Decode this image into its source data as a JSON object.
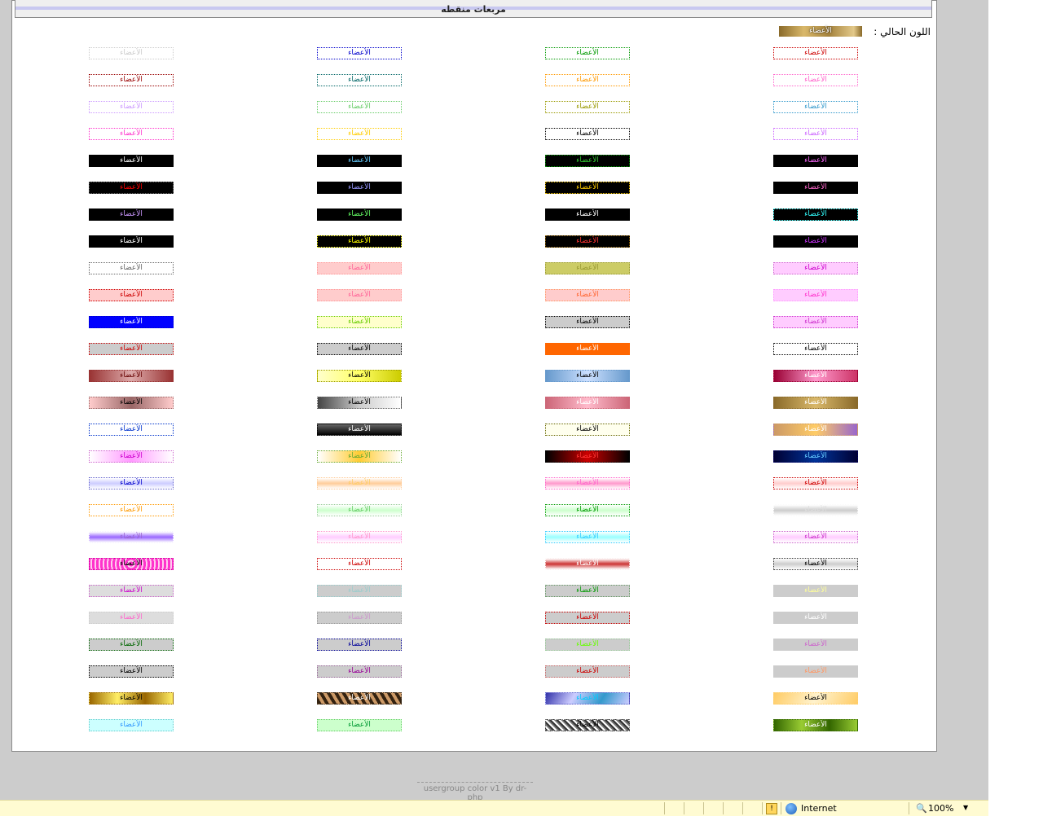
{
  "page": {
    "header_title": "مربعات منقطه",
    "current_label": "اللون الحالي :",
    "swatch_text": "الأعضاء",
    "footer": "usergroup color v1 By dr-php"
  },
  "statusbar": {
    "zone": "Internet",
    "zoom": "100%"
  },
  "colors": {
    "window_bg": "#cccccc",
    "header_bar": "#c8c8f0",
    "statusbar_bg": "#fffbd2"
  },
  "swatches": [
    {
      "bg": "#ffffff",
      "fg": "#cccccc",
      "border": "#cccccc"
    },
    {
      "bg": "#ffffff",
      "fg": "#0000cc",
      "border": "#0000cc"
    },
    {
      "bg": "#ffffff",
      "fg": "#009900",
      "border": "#009900"
    },
    {
      "bg": "#ffffff",
      "fg": "#cc0000",
      "border": "#cc0000"
    },
    {
      "bg": "#ffffff",
      "fg": "#990000",
      "border": "#990000"
    },
    {
      "bg": "#ffffff",
      "fg": "#006666",
      "border": "#006666"
    },
    {
      "bg": "#ffffff",
      "fg": "#ff9900",
      "border": "#ff9900"
    },
    {
      "bg": "#ffffff",
      "fg": "#ff66cc",
      "border": "#ff66cc"
    },
    {
      "bg": "#ffffff",
      "fg": "#cc99ff",
      "border": "#cc99ff"
    },
    {
      "bg": "#ffffff",
      "fg": "#66cc66",
      "border": "#66cc66"
    },
    {
      "bg": "#ffffff",
      "fg": "#999900",
      "border": "#999900"
    },
    {
      "bg": "#ffffff",
      "fg": "#3399cc",
      "border": "#3399cc"
    },
    {
      "bg": "#ffffff",
      "fg": "#ff33cc",
      "border": "#ff33cc"
    },
    {
      "bg": "#ffffff",
      "fg": "#ffcc00",
      "border": "#ffcc00"
    },
    {
      "bg": "#ffffff",
      "fg": "#000000",
      "border": "#000000"
    },
    {
      "bg": "#ffffff",
      "fg": "#cc66ff",
      "border": "#cc66ff"
    },
    {
      "bg": "#000000",
      "fg": "#ffffff",
      "border": "#000000"
    },
    {
      "bg": "#000000",
      "fg": "#66ccff",
      "border": "#000000"
    },
    {
      "bg": "#000000",
      "fg": "#33cc33",
      "border": "#009900"
    },
    {
      "bg": "#000000",
      "fg": "#ff66ff",
      "border": "#000000"
    },
    {
      "bg": "#000000",
      "fg": "#ff0000",
      "border": "#666666"
    },
    {
      "bg": "#000000",
      "fg": "#9999ff",
      "border": "#000000"
    },
    {
      "bg": "#000000",
      "fg": "#ffcc00",
      "border": "#ffcc00"
    },
    {
      "bg": "#000000",
      "fg": "#ff66cc",
      "border": "#000000"
    },
    {
      "bg": "#000000",
      "fg": "#cc99ff",
      "border": "#000000"
    },
    {
      "bg": "#000000",
      "fg": "#66ff66",
      "border": "#000000"
    },
    {
      "bg": "#000000",
      "fg": "#ffffff",
      "border": "#000000"
    },
    {
      "bg": "#000000",
      "fg": "#33ffff",
      "border": "#33ffff"
    },
    {
      "bg": "#000000",
      "fg": "#ffffff",
      "border": "#000000"
    },
    {
      "bg": "#000000",
      "fg": "#ffff00",
      "border": "#ffff00"
    },
    {
      "bg": "#000000",
      "fg": "#ff3333",
      "border": "#996600"
    },
    {
      "bg": "#000000",
      "fg": "#cc33ff",
      "border": "#000000"
    },
    {
      "bg": "#ffffff",
      "fg": "#666666",
      "border": "#666666"
    },
    {
      "bg": "#ffcccc",
      "fg": "#ff6699",
      "border": "#ff9999"
    },
    {
      "bg": "#cccc66",
      "fg": "#999933",
      "border": "#999933"
    },
    {
      "bg": "#ffccff",
      "fg": "#cc00cc",
      "border": "#cc66cc"
    },
    {
      "bg": "#ffcccc",
      "fg": "#cc0000",
      "border": "#cc0000"
    },
    {
      "bg": "#ffcccc",
      "fg": "#ff6699",
      "border": "#ff9999"
    },
    {
      "bg": "#ffcccc",
      "fg": "#ff6633",
      "border": "#ff9966"
    },
    {
      "bg": "#ffccff",
      "fg": "#ff33cc",
      "border": "#ff99ff"
    },
    {
      "bg": "#0000ff",
      "fg": "#ffffff",
      "border": "#0000cc"
    },
    {
      "bg": "#ffffcc",
      "fg": "#66cc00",
      "border": "#66cc00"
    },
    {
      "bg": "#cccccc",
      "fg": "#000000",
      "border": "#000000"
    },
    {
      "bg": "#ffccff",
      "fg": "#cc33cc",
      "border": "#cc33cc"
    },
    {
      "bg": "#cccccc",
      "fg": "#cc0000",
      "border": "#cc0000"
    },
    {
      "bg": "#cccccc",
      "fg": "#000000",
      "border": "#000000"
    },
    {
      "bg": "#ff6600",
      "fg": "#ffffff",
      "border": "#ff6600"
    },
    {
      "bg": "#ffffff",
      "fg": "#000000",
      "border": "#000000"
    },
    {
      "bg": "linear-gradient(90deg,#993333,#ddaaaa,#993333)",
      "fg": "#660000",
      "border": "#993333"
    },
    {
      "bg": "linear-gradient(90deg,#ffffcc,#ffff66,#cccc00)",
      "fg": "#000000",
      "border": "#999900"
    },
    {
      "bg": "linear-gradient(90deg,#6699cc,#cce0ff,#6699cc)",
      "fg": "#000000",
      "border": "#6699cc"
    },
    {
      "bg": "linear-gradient(90deg,#990033,#ff99cc,#cc3366)",
      "fg": "#ffffff",
      "border": "#990033"
    },
    {
      "bg": "linear-gradient(90deg,#ffcccc,#996666,#ffcccc)",
      "fg": "#000000",
      "border": "#996666"
    },
    {
      "bg": "linear-gradient(90deg,#444444,#cccccc,#ffffff)",
      "fg": "#000000",
      "border": "#666666"
    },
    {
      "bg": "linear-gradient(90deg,#cc6677,#ffbbcc,#cc6677)",
      "fg": "#ffffff",
      "border": "#cc6677"
    },
    {
      "bg": "linear-gradient(90deg,#8a6a2a,#d9b86a,#8a6a2a)",
      "fg": "#ffffff",
      "border": "#8a6a2a"
    },
    {
      "bg": "#ffffff",
      "fg": "#0033cc",
      "border": "#0033cc"
    },
    {
      "bg": "linear-gradient(180deg,#666666,#000000)",
      "fg": "#ffffff",
      "border": "#000000"
    },
    {
      "bg": "#ffffee",
      "fg": "#000000",
      "border": "#666600"
    },
    {
      "bg": "linear-gradient(90deg,#cc9966,#ffcc66,#9966cc)",
      "fg": "#ffffff",
      "border": "#cc9966"
    },
    {
      "bg": "linear-gradient(90deg,#ffffff,#ff99ff,#ffffff)",
      "fg": "#cc00cc",
      "border": "#cc66cc"
    },
    {
      "bg": "linear-gradient(90deg,#ffffff,#ffcc33,#ffffff)",
      "fg": "#66aa33",
      "border": "#66aa33"
    },
    {
      "bg": "linear-gradient(90deg,#000000,#cc0000,#000000)",
      "fg": "#ff3333",
      "border": "#000000"
    },
    {
      "bg": "linear-gradient(90deg,#000033,#003399,#000033)",
      "fg": "#66ccff",
      "border": "#000066"
    },
    {
      "bg": "linear-gradient(180deg,#ffffff,#ccccff,#ffffff)",
      "fg": "#0000cc",
      "border": "#6666cc"
    },
    {
      "bg": "linear-gradient(180deg,#ffffff,#ffcc99,#ffffff)",
      "fg": "#ffcc66",
      "border": "#ffcc99"
    },
    {
      "bg": "linear-gradient(180deg,#ffffff,#ff99cc,#ffffff)",
      "fg": "#ff66cc",
      "border": "#ff66cc"
    },
    {
      "bg": "linear-gradient(180deg,#ffffff,#ffcccc,#ffffff)",
      "fg": "#cc0000",
      "border": "#cc0000"
    },
    {
      "bg": "#ffffff",
      "fg": "#ff9900",
      "border": "#ff9900"
    },
    {
      "bg": "linear-gradient(180deg,#ffffff,#ccffcc,#ffffff)",
      "fg": "#66cc66",
      "border": "#99cc99"
    },
    {
      "bg": "linear-gradient(180deg,#ffffff,#ccffcc,#ffffff)",
      "fg": "#009900",
      "border": "#009900"
    },
    {
      "bg": "linear-gradient(180deg,#ffffff,#cccccc,#ffffff)",
      "fg": "#dddddd",
      "border": "#ffffff"
    },
    {
      "bg": "linear-gradient(180deg,#ffffff,#9966ff,#ffffff)",
      "fg": "#9966cc",
      "border": "#ffffff"
    },
    {
      "bg": "linear-gradient(180deg,#ffffff,#ffccff,#ffffff)",
      "fg": "#ff99cc",
      "border": "#ff99cc"
    },
    {
      "bg": "linear-gradient(180deg,#ffffff,#99ffff,#ffffff)",
      "fg": "#33ccff",
      "border": "#33ccff"
    },
    {
      "bg": "linear-gradient(180deg,#ffffff,#ffccff,#ffffff)",
      "fg": "#cc33cc",
      "border": "#cc66cc"
    },
    {
      "bg": "repeating-radial-gradient(circle,#ff33cc 0 3px,#ffccee 3px 5px)",
      "fg": "#000000",
      "border": "#cc0099"
    },
    {
      "bg": "#ffffff",
      "fg": "#cc0000",
      "border": "#cc0000"
    },
    {
      "bg": "linear-gradient(180deg,#ffffff,#cc3333,#ffffff)",
      "fg": "#ffffff",
      "border": "#ffffff"
    },
    {
      "bg": "linear-gradient(180deg,#ffffff,#cccccc,#ffffff)",
      "fg": "#000000",
      "border": "#333333"
    },
    {
      "bg": "#dddddd",
      "fg": "#cc00cc",
      "border": "#cc66cc"
    },
    {
      "bg": "#cccccc",
      "fg": "#99cccc",
      "border": "#99cccc"
    },
    {
      "bg": "#cccccc",
      "fg": "#009900",
      "border": "#669966"
    },
    {
      "bg": "#cccccc",
      "fg": "#ffff99",
      "border": "#cccccc"
    },
    {
      "bg": "#dddddd",
      "fg": "#ff66cc",
      "border": "#cccccc"
    },
    {
      "bg": "#cccccc",
      "fg": "#cc99cc",
      "border": "#999999"
    },
    {
      "bg": "#cccccc",
      "fg": "#cc0000",
      "border": "#cc0000"
    },
    {
      "bg": "#cccccc",
      "fg": "#ffffff",
      "border": "#cccccc"
    },
    {
      "bg": "#cccccc",
      "fg": "#006600",
      "border": "#006600"
    },
    {
      "bg": "#cccccc",
      "fg": "#000099",
      "border": "#000099"
    },
    {
      "bg": "#cccccc",
      "fg": "#66ff00",
      "border": "#99cc99"
    },
    {
      "bg": "#cccccc",
      "fg": "#cc66cc",
      "border": "#cccccc"
    },
    {
      "bg": "#cccccc",
      "fg": "#000000",
      "border": "#000000"
    },
    {
      "bg": "#cccccc",
      "fg": "#990099",
      "border": "#996699"
    },
    {
      "bg": "#cccccc",
      "fg": "#cc0000",
      "border": "#cc6666"
    },
    {
      "bg": "#cccccc",
      "fg": "#ff9966",
      "border": "#cccccc"
    },
    {
      "bg": "linear-gradient(90deg,#996600,#ffee66,#996600,#ffee66)",
      "fg": "#000000",
      "border": "#996600"
    },
    {
      "bg": "repeating-linear-gradient(60deg,#332211 0 4px,#cc9966 4px 8px)",
      "fg": "#ffffff",
      "border": "#332211"
    },
    {
      "bg": "linear-gradient(120deg,#3333aa,#ccccff,#3399cc,#ccccff)",
      "fg": "#00ccff",
      "border": "#6666cc"
    },
    {
      "bg": "linear-gradient(120deg,#ffcc66,#fff2cc,#ffcc66)",
      "fg": "#000000",
      "border": "#ffcc66"
    },
    {
      "bg": "#ccffff",
      "fg": "#3399ff",
      "border": "#66cccc"
    },
    {
      "bg": "#ccffcc",
      "fg": "#009933",
      "border": "#66cc66"
    },
    {
      "bg": "repeating-linear-gradient(45deg,#333333 0 2px,#ffffff 2px 4px,#777777 4px 6px)",
      "fg": "#000000",
      "border": "#777777"
    },
    {
      "bg": "linear-gradient(90deg,#336600,#99cc33,#336600,#99cc33)",
      "fg": "#ffffff",
      "border": "#336600"
    }
  ]
}
